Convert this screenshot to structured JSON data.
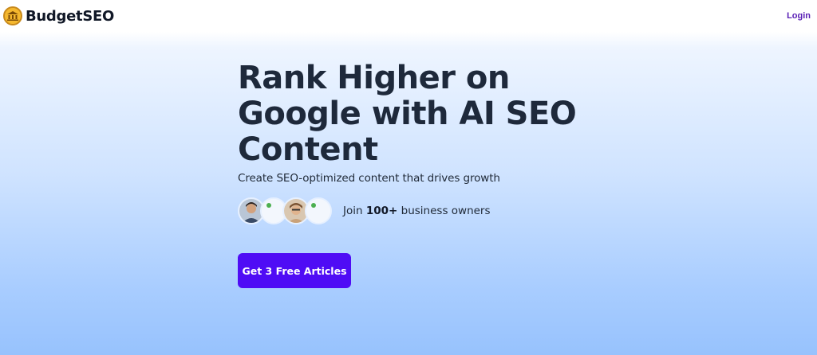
{
  "nav": {
    "brand": "BudgetSEO",
    "logo_icon": "coin-bank-icon",
    "login_label": "Login",
    "accent": "#5b21b6"
  },
  "hero": {
    "headline_lines": [
      "Rank Higher on",
      "Google with AI SEO",
      "Content"
    ],
    "subheadline": "Create SEO-optimized content that drives growth",
    "social_proof": {
      "prefix": "Join ",
      "count": "100+",
      "suffix": " business owners",
      "avatars": [
        "user-avatar-1",
        "user-avatar-2",
        "user-avatar-3",
        "user-avatar-4"
      ]
    },
    "cta_label": "Get 3 Free Articles",
    "cta_color": "#4f0cf5"
  }
}
